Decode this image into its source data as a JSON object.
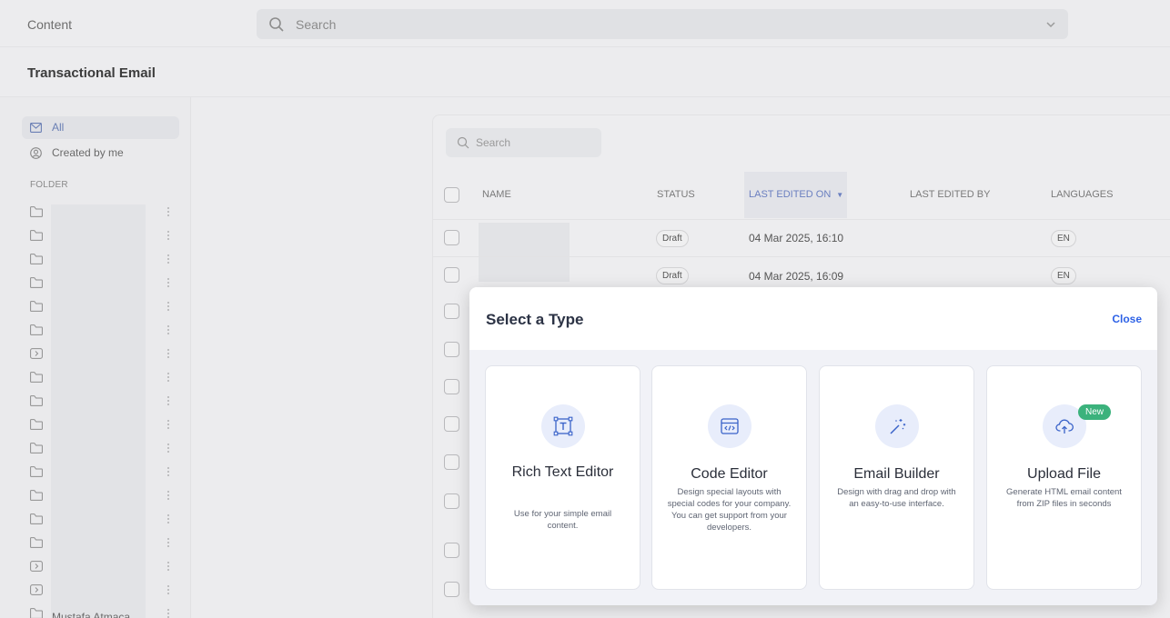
{
  "topbar": {
    "app_title": "Content",
    "search_placeholder": "Search"
  },
  "section": {
    "title": "Transactional Email"
  },
  "sidebar": {
    "all_label": "All",
    "created_by_me_label": "Created by me",
    "folder_heading": "FOLDER",
    "last_folder_label": "Mustafa Atmaca"
  },
  "table": {
    "search_placeholder": "Search",
    "columns": {
      "name": "NAME",
      "status": "STATUS",
      "last_edited_on": "LAST EDITED ON",
      "last_edited_by": "LAST EDITED BY",
      "languages": "LANGUAGES"
    },
    "rows": [
      {
        "status": "Draft",
        "last_edited_on": "04 Mar 2025, 16:10",
        "language": "EN"
      },
      {
        "status": "Draft",
        "last_edited_on": "04 Mar 2025, 16:09",
        "language": "EN"
      }
    ]
  },
  "modal": {
    "title": "Select a Type",
    "close_label": "Close",
    "cards": [
      {
        "title": "Rich Text Editor",
        "description": "Use for your simple email content.",
        "icon": "text-box-icon"
      },
      {
        "title": "Code Editor",
        "description": "Design special layouts with special codes for your company. You can get support from your developers.",
        "icon": "code-window-icon"
      },
      {
        "title": "Email Builder",
        "description": "Design with drag and drop with an easy-to-use interface.",
        "icon": "magic-wand-icon"
      },
      {
        "title": "Upload File",
        "description": "Generate HTML email content from ZIP files in seconds",
        "icon": "cloud-upload-icon",
        "badge": "New"
      }
    ]
  },
  "colors": {
    "accent": "#2e62e6",
    "badge_green": "#3bb27c",
    "icon_bg": "#e8edfb"
  }
}
